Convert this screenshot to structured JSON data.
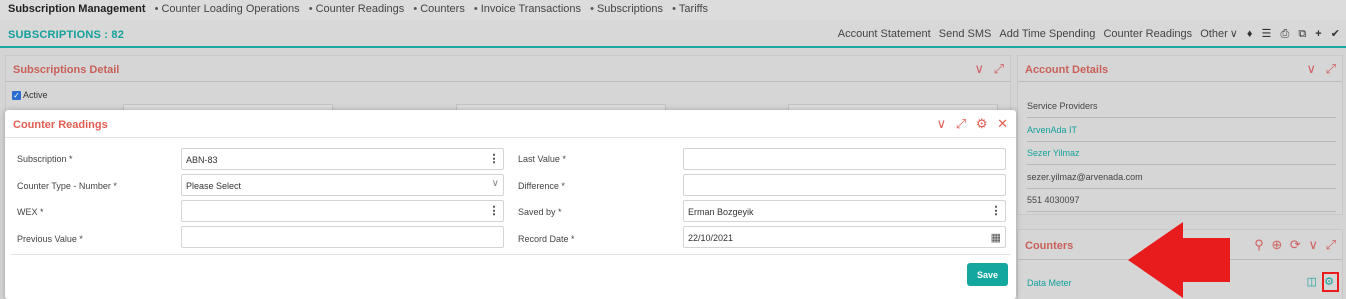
{
  "topnav": {
    "items": [
      "Subscription Management",
      "Counter Loading Operations",
      "Counter Readings",
      "Counters",
      "Invoice Transactions",
      "Subscriptions",
      "Tariffs"
    ]
  },
  "header": {
    "title": "SUBSCRIPTIONS : 82",
    "actions": [
      "Account Statement",
      "Send SMS",
      "Add Time Spending",
      "Counter Readings",
      "Other"
    ]
  },
  "subscriptions_detail": {
    "title": "Subscriptions Detail",
    "active_label": "Active"
  },
  "account_details": {
    "title": "Account Details",
    "lines": [
      "Service Providers",
      "ArvenAda IT",
      "Sezer Yilmaz",
      "sezer.yilmaz@arvenada.com",
      "551 4030097"
    ]
  },
  "counters": {
    "title": "Counters",
    "items": [
      "Data Meter"
    ]
  },
  "modal": {
    "title": "Counter Readings",
    "left": {
      "subscription_label": "Subscription *",
      "subscription_value": "ABN-83",
      "counter_type_label": "Counter Type - Number *",
      "counter_type_value": "Please Select",
      "wex_label": "WEX *",
      "wex_value": "",
      "previous_value_label": "Previous Value *",
      "previous_value_value": ""
    },
    "right": {
      "last_value_label": "Last Value *",
      "last_value_value": "",
      "difference_label": "Difference *",
      "difference_value": "",
      "saved_by_label": "Saved by *",
      "saved_by_value": "Erman Bozgeyik",
      "record_date_label": "Record Date *",
      "record_date_value": "22/10/2021"
    },
    "save_label": "Save"
  },
  "colors": {
    "accent": "#14a7a0",
    "panel_title": "#c9605a",
    "modal_title": "#e35e52",
    "highlight": "#e81c1c"
  }
}
